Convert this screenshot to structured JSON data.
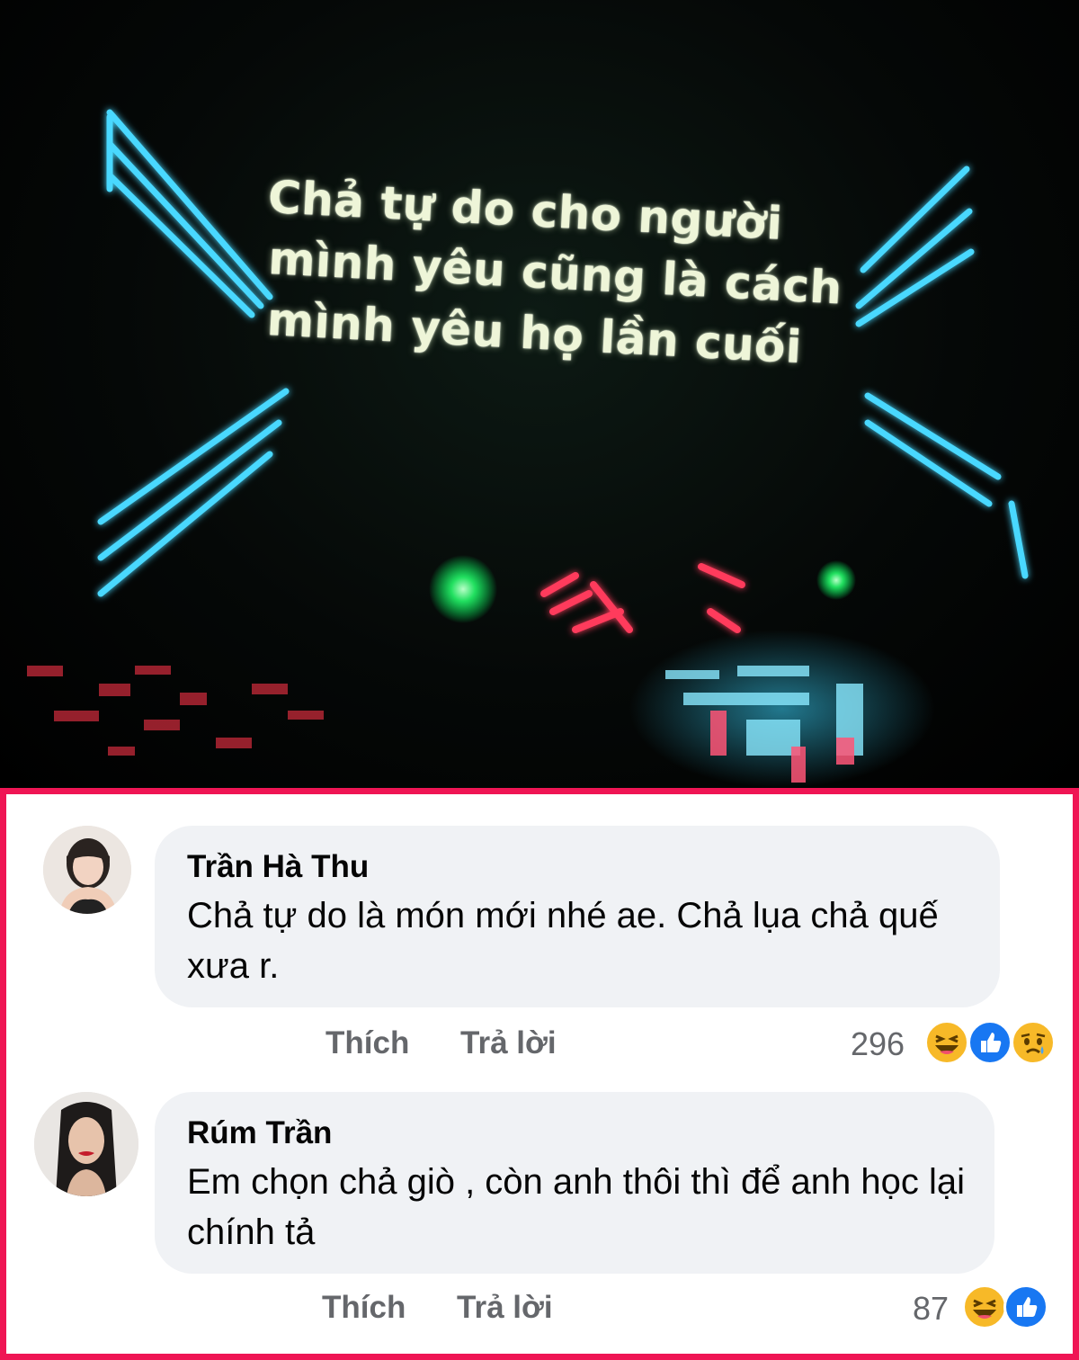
{
  "photo": {
    "lyric_lines": [
      "Chả tự do cho người",
      "mình yêu cũng là cách",
      "mình yêu họ lần cuối"
    ]
  },
  "comments": [
    {
      "name": "Trần Hà Thu",
      "text": "Chả tự do là món mới nhé ae. Chả lụa chả quế xưa r.",
      "like_label": "Thích",
      "reply_label": "Trả lời",
      "reaction_count": "296",
      "reactions": [
        "haha-icon",
        "like-icon",
        "sad-icon"
      ]
    },
    {
      "name": "Rúm Trần",
      "text": "Em chọn chả giò , còn anh thôi thì để anh học lại chính tả",
      "like_label": "Thích",
      "reply_label": "Trả lời",
      "reaction_count": "87",
      "reactions": [
        "haha-icon",
        "like-icon"
      ]
    }
  ],
  "colors": {
    "panel_border": "#ef1554",
    "bubble": "#f0f2f5",
    "meta_text": "#65676b",
    "like_blue": "#1877f2",
    "haha_yellow": "#f7b928"
  }
}
